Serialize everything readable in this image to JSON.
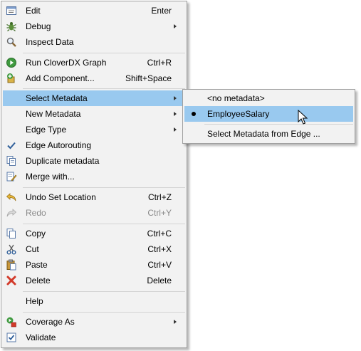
{
  "menu": {
    "edit": {
      "label": "Edit",
      "shortcut": "Enter",
      "icon": "edit-icon"
    },
    "debug": {
      "label": "Debug",
      "icon": "debug-bug-icon"
    },
    "inspect_data": {
      "label": "Inspect Data",
      "icon": "magnifier-icon"
    },
    "run_graph": {
      "label": "Run CloverDX Graph",
      "shortcut": "Ctrl+R",
      "icon": "run-icon"
    },
    "add_component": {
      "label": "Add Component...",
      "shortcut": "Shift+Space",
      "icon": "add-component-icon"
    },
    "select_metadata": {
      "label": "Select Metadata"
    },
    "new_metadata": {
      "label": "New Metadata"
    },
    "edge_type": {
      "label": "Edge Type"
    },
    "edge_autorouting": {
      "label": "Edge Autorouting",
      "checked": true
    },
    "duplicate_metadata": {
      "label": "Duplicate metadata",
      "icon": "duplicate-icon"
    },
    "merge_with": {
      "label": "Merge with...",
      "icon": "merge-icon"
    },
    "undo": {
      "label": "Undo Set Location",
      "shortcut": "Ctrl+Z",
      "icon": "undo-icon"
    },
    "redo": {
      "label": "Redo",
      "shortcut": "Ctrl+Y",
      "icon": "redo-icon",
      "disabled": true
    },
    "copy": {
      "label": "Copy",
      "shortcut": "Ctrl+C",
      "icon": "copy-icon"
    },
    "cut": {
      "label": "Cut",
      "shortcut": "Ctrl+X",
      "icon": "scissors-icon"
    },
    "paste": {
      "label": "Paste",
      "shortcut": "Ctrl+V",
      "icon": "paste-icon"
    },
    "delete": {
      "label": "Delete",
      "shortcut": "Delete",
      "icon": "delete-x-icon"
    },
    "help": {
      "label": "Help"
    },
    "coverage_as": {
      "label": "Coverage As",
      "icon": "coverage-icon"
    },
    "validate": {
      "label": "Validate",
      "checked": true
    }
  },
  "submenu": {
    "no_metadata": {
      "label": "<no metadata>"
    },
    "employee_salary": {
      "label": "EmployeeSalary",
      "selected": true
    },
    "select_from_edge": {
      "label": "Select Metadata from Edge ..."
    }
  },
  "colors": {
    "menu_bg": "#f2f2f2",
    "highlight": "#99c9ef",
    "separator": "#d4d4d4",
    "disabled_text": "#8a8a8a"
  }
}
